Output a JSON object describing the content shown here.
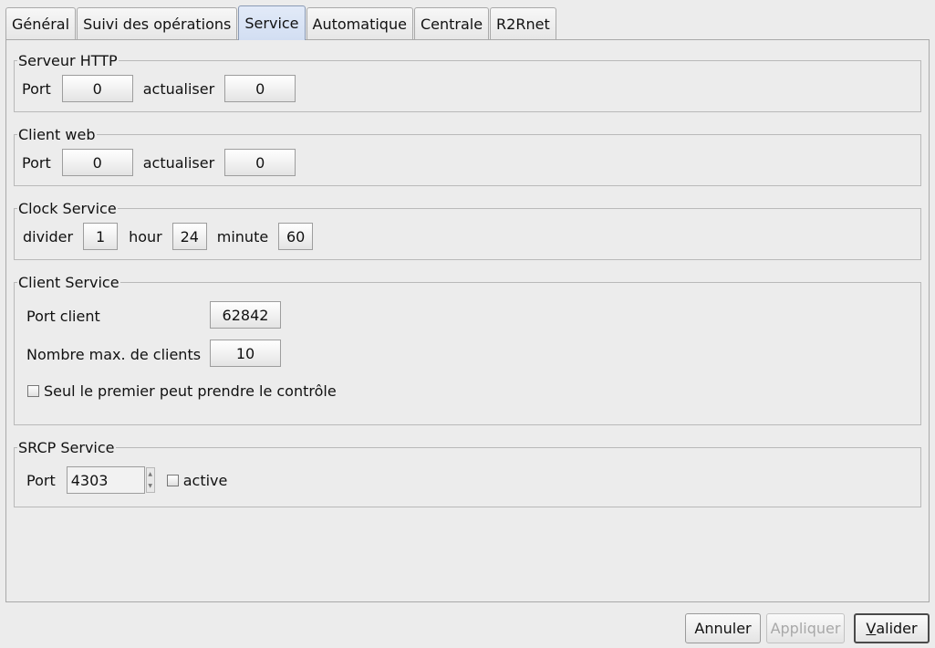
{
  "tabs": [
    {
      "label": "Général"
    },
    {
      "label": "Suivi des opérations"
    },
    {
      "label": "Service"
    },
    {
      "label": "Automatique"
    },
    {
      "label": "Centrale"
    },
    {
      "label": "R2Rnet"
    }
  ],
  "active_tab": "Service",
  "http_server": {
    "title": "Serveur HTTP",
    "port_label": "Port",
    "port_value": "0",
    "refresh_label": "actualiser",
    "refresh_value": "0"
  },
  "web_client": {
    "title": "Client web",
    "port_label": "Port",
    "port_value": "0",
    "refresh_label": "actualiser",
    "refresh_value": "0"
  },
  "clock_service": {
    "title": "Clock Service",
    "divider_label": "divider",
    "divider_value": "1",
    "hour_label": "hour",
    "hour_value": "24",
    "minute_label": "minute",
    "minute_value": "60"
  },
  "client_service": {
    "title": "Client Service",
    "port_label": "Port client",
    "port_value": "62842",
    "max_label": "Nombre max. de clients",
    "max_value": "10",
    "first_only_label": "Seul le premier peut prendre le contrôle",
    "first_only_checked": false
  },
  "srcp_service": {
    "title": "SRCP Service",
    "port_label": "Port",
    "port_value": "4303",
    "active_label": "active",
    "active_checked": false
  },
  "buttons": {
    "cancel": "Annuler",
    "apply": "Appliquer",
    "ok_prefix": "V",
    "ok_rest": "alider"
  }
}
